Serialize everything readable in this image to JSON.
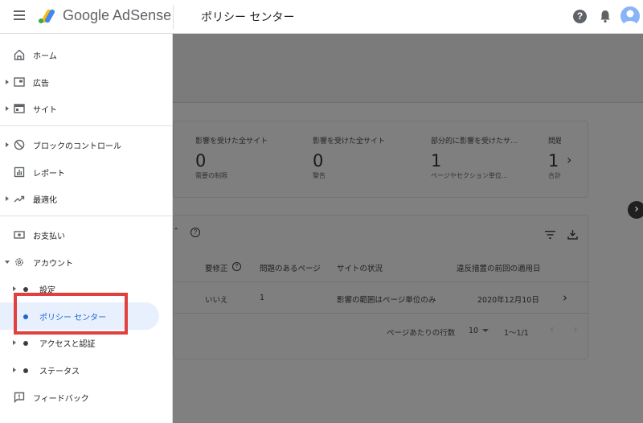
{
  "app": {
    "brand": "Google AdSense",
    "page_title": "ポリシー センター"
  },
  "sidebar": {
    "items": [
      {
        "label": "ホーム",
        "icon": "home-icon"
      },
      {
        "label": "広告",
        "icon": "ads-icon"
      },
      {
        "label": "サイト",
        "icon": "sites-icon"
      },
      {
        "label": "ブロックのコントロール",
        "icon": "block-icon"
      },
      {
        "label": "レポート",
        "icon": "report-icon"
      },
      {
        "label": "最適化",
        "icon": "optimize-icon"
      },
      {
        "label": "お支払い",
        "icon": "payments-icon"
      },
      {
        "label": "アカウント",
        "icon": "gear-icon"
      },
      {
        "label": "設定",
        "icon": "dot-icon"
      },
      {
        "label": "ポリシー センター",
        "icon": "dot-icon",
        "selected": true
      },
      {
        "label": "アクセスと認証",
        "icon": "dot-icon"
      },
      {
        "label": "ステータス",
        "icon": "dot-icon"
      },
      {
        "label": "フィードバック",
        "icon": "feedback-icon"
      }
    ]
  },
  "summary": {
    "stats": [
      {
        "label": "影響を受けた全サイト",
        "value": "0",
        "sub": "需要の制限"
      },
      {
        "label": "影響を受けた全サイト",
        "value": "0",
        "sub": "警告"
      },
      {
        "label": "部分的に影響を受けたサ...",
        "value": "1",
        "sub": "ページやセクション単位..."
      },
      {
        "label": "問題のあるペ",
        "value": "1",
        "sub": "合計"
      }
    ]
  },
  "table": {
    "columns": [
      "要修正",
      "問題のあるページ",
      "サイトの状況",
      "違反措置の前回の適用日"
    ],
    "rows": [
      {
        "fix": "いいえ",
        "pages": "1",
        "status": "影響の範囲はページ単位のみ",
        "date": "2020年12月10日"
      }
    ],
    "pagination": {
      "rows_label": "ページあたりの行数",
      "rows_value": "10",
      "range": "1〜1/1"
    }
  },
  "colors": {
    "accent": "#1967d2",
    "highlight": "#e0413e",
    "selected_bg": "#e8f0fe"
  }
}
